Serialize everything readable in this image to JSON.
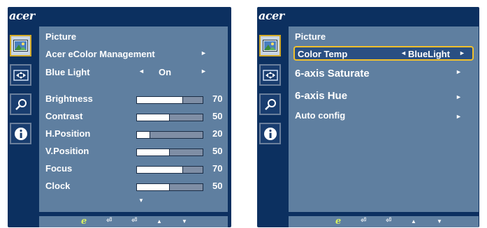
{
  "left_osd": {
    "brand": "acer",
    "menu_title": "Picture",
    "ecolor": {
      "label": "Acer eColor Management",
      "arrow": "►"
    },
    "bluelight": {
      "label": "Blue Light",
      "left_arrow": "◄",
      "value": "On",
      "right_arrow": "►"
    },
    "sliders": [
      {
        "label": "Brightness",
        "value": "70",
        "level": 0.7
      },
      {
        "label": "Contrast",
        "value": "50",
        "level": 0.5
      },
      {
        "label": "H.Position",
        "value": "20",
        "level": 0.2
      },
      {
        "label": "V.Position",
        "value": "50",
        "level": 0.5
      },
      {
        "label": "Focus",
        "value": "70",
        "level": 0.7
      },
      {
        "label": "Clock",
        "value": "50",
        "level": 0.5
      }
    ],
    "scroll_down": "▼"
  },
  "right_osd": {
    "brand": "acer",
    "menu_title": "Picture",
    "color_temp": {
      "label": "Color Temp",
      "left_arrow": "◄",
      "value": "BlueLight",
      "right_arrow": "►"
    },
    "six_axis_saturate": {
      "label": "6-axis Saturate",
      "arrow": "►"
    },
    "six_axis_hue": {
      "label": "6-axis Hue",
      "arrow": "►"
    },
    "auto_config": {
      "label": "Auto config",
      "arrow": "►"
    }
  },
  "footer": {
    "e_key": "e",
    "input1": "⏎",
    "input2": "⏎",
    "up": "▲",
    "down": "▼"
  },
  "colors": {
    "osd_bg": "#0c3060",
    "panel_bg": "#5f7fa0",
    "highlight_border": "#f0c02c",
    "active_icon_border": "#d2a927"
  },
  "icons": [
    "picture-icon",
    "position-icon",
    "settings-icon",
    "info-icon"
  ]
}
